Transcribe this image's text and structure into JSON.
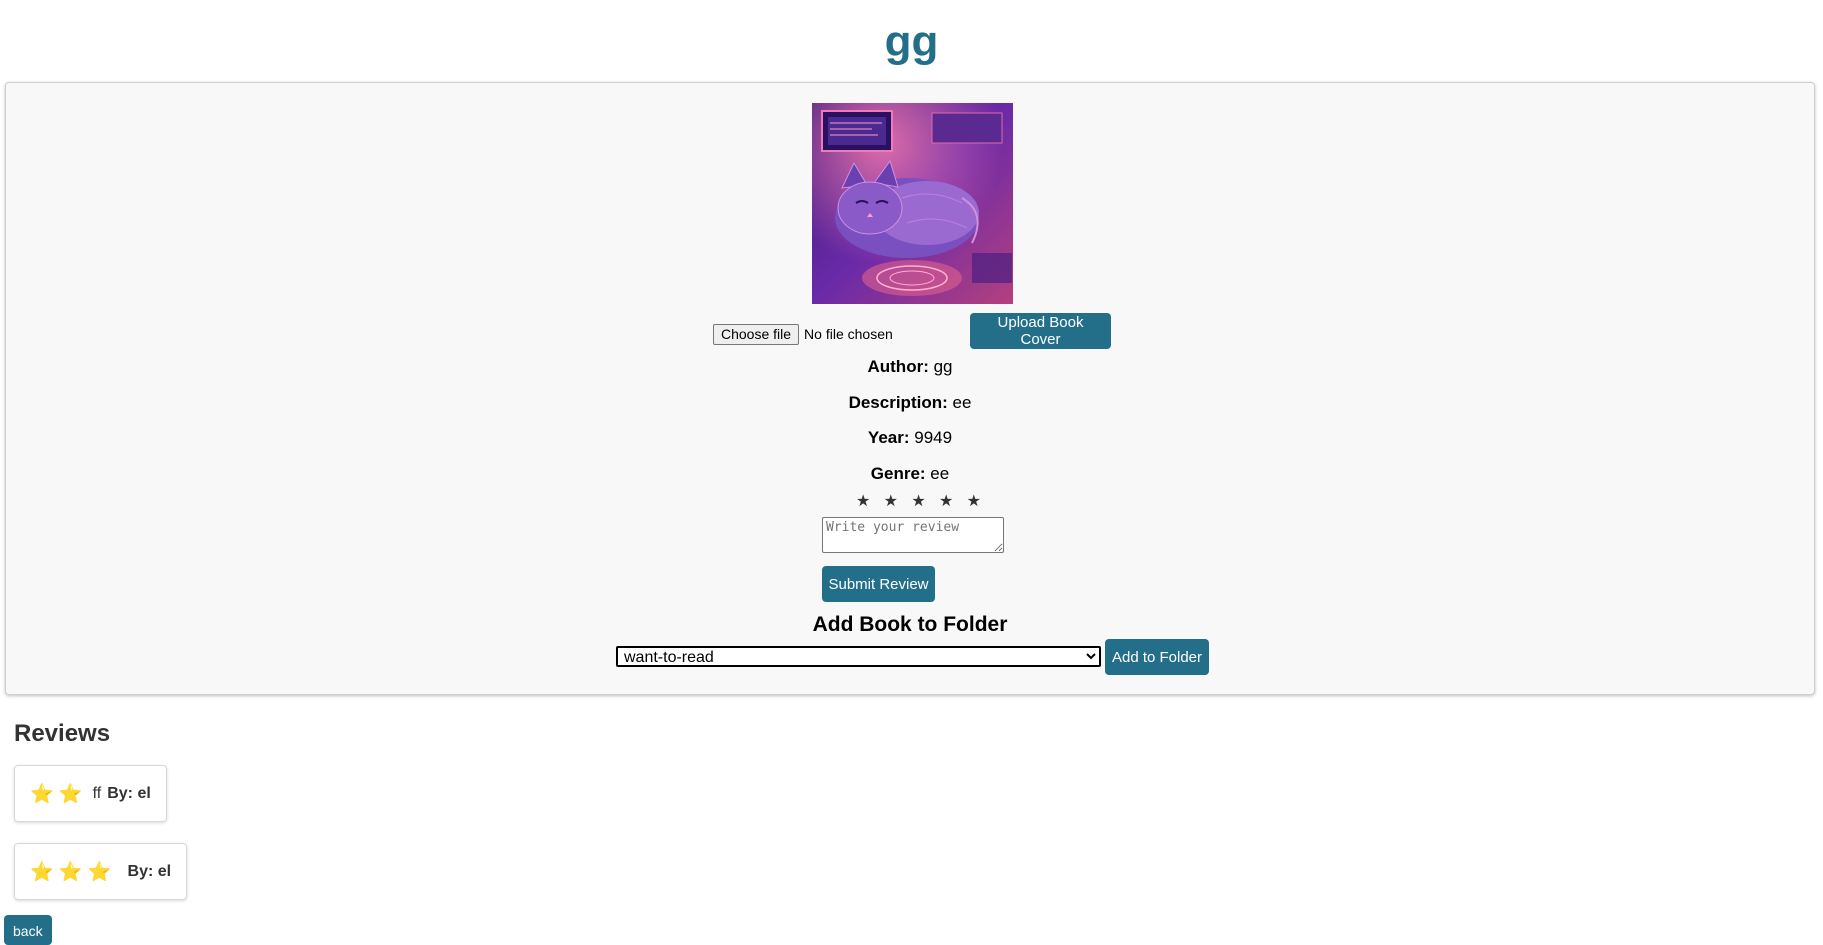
{
  "book": {
    "title": "gg",
    "author_label": "Author:",
    "author": "gg",
    "description_label": "Description:",
    "description": "ee",
    "year_label": "Year:",
    "year": "9949",
    "genre_label": "Genre:",
    "genre": "ee"
  },
  "upload": {
    "choose_file_label": "Choose file",
    "file_status": "No file chosen",
    "upload_button_label": "Upload Book Cover"
  },
  "rating": {
    "stars": [
      "★",
      "★",
      "★",
      "★",
      "★"
    ],
    "review_placeholder": "Write your review",
    "submit_label": "Submit Review"
  },
  "folder": {
    "title": "Add Book to Folder",
    "selected": "want-to-read",
    "button_label": "Add to Folder"
  },
  "reviews": {
    "title": "Reviews",
    "items": [
      {
        "stars": "⭐ ⭐",
        "rating": 2,
        "text": "ff",
        "by_label": "By:",
        "author": "el"
      },
      {
        "stars": "⭐ ⭐ ⭐",
        "rating": 3,
        "text": "",
        "by_label": "By:",
        "author": "el"
      }
    ]
  },
  "nav": {
    "back_label": "back"
  },
  "colors": {
    "accent": "#236f8a",
    "star": "#f2c21b",
    "card_bg": "#f8f8f8"
  }
}
